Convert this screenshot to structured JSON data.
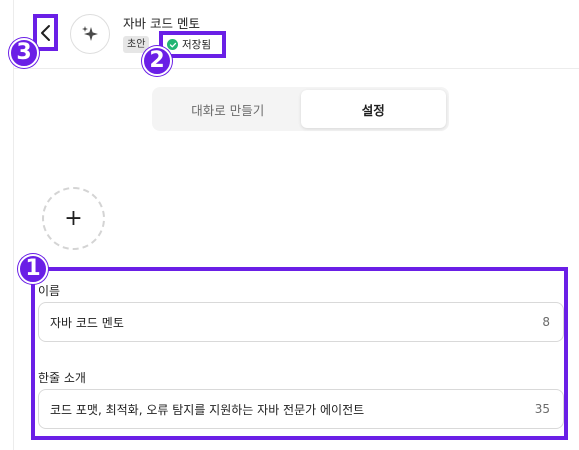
{
  "header": {
    "gpt_name": "자바 코드 멘토",
    "draft_tag": "초안",
    "saved_status": "저장됨"
  },
  "tabs": [
    {
      "label": "대화로 만들기",
      "active": false
    },
    {
      "label": "설정",
      "active": true
    }
  ],
  "upload": {
    "icon": "+"
  },
  "form": {
    "name_label": "이름",
    "name_value": "자바 코드 멘토",
    "name_count": "8",
    "desc_label": "한줄 소개",
    "desc_value": "코드 포맷, 최적화, 오류 탐지를 지원하는 자바 전문가 에이전트",
    "desc_count": "35"
  },
  "annotations": {
    "badge_1": "1",
    "badge_2": "2",
    "badge_3": "3"
  },
  "colors": {
    "annotation": "#6a1fe6",
    "saved_check": "#22b573"
  }
}
